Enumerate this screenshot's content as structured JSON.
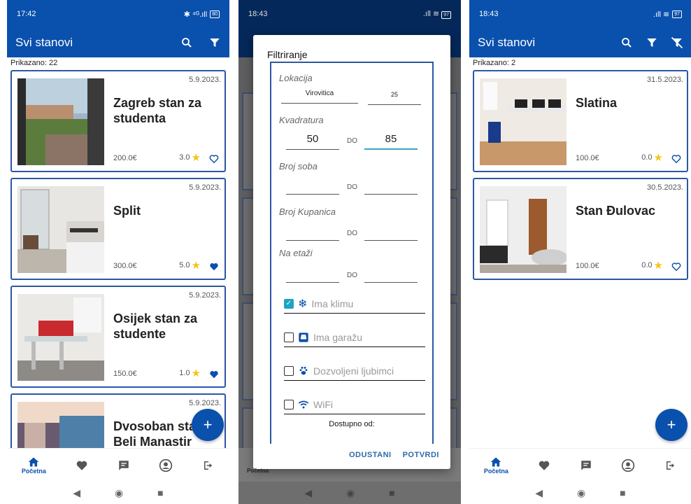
{
  "screen1": {
    "status_time": "17:42",
    "status_icons": "✉ 𝕏",
    "status_right": "✱ ⁴ᴳ.ıll",
    "battery": "80",
    "title": "Svi stanovi",
    "count": "Prikazano: 22",
    "listings": [
      {
        "date": "5.9.2023.",
        "name": "Zagreb stan za studenta",
        "price": "200.0€",
        "rating": "3.0",
        "favorite": false
      },
      {
        "date": "5.9.2023.",
        "name": "Split",
        "price": "300.0€",
        "rating": "5.0",
        "favorite": true
      },
      {
        "date": "5.9.2023.",
        "name": "Osijek stan za studente",
        "price": "150.0€",
        "rating": "1.0",
        "favorite": true
      },
      {
        "date": "5.9.2023.",
        "name": "Dvosoban stan Beli Manastir",
        "price": "",
        "rating": "",
        "favorite": false
      }
    ],
    "fab_label": "+",
    "nav_home_label": "Početna"
  },
  "screen2": {
    "status_time": "18:43",
    "battery": "97",
    "dialog_title": "Filtriranje",
    "location_label": "Lokacija",
    "location_value": "Virovitica",
    "location_radius": "25",
    "area_label": "Kvadratura",
    "area_min": "50",
    "area_max": "85",
    "do_label": "DO",
    "rooms_label": "Broj soba",
    "bathrooms_label": "Broj Kupanica",
    "floor_label": "Na etaži",
    "checkboxes": [
      {
        "label": "Ima klimu",
        "checked": true,
        "icon": "snowflake-icon"
      },
      {
        "label": "Ima garažu",
        "checked": false,
        "icon": "garage-icon"
      },
      {
        "label": "Dozvoljeni ljubimci",
        "checked": false,
        "icon": "paw-icon"
      },
      {
        "label": "WiFi",
        "checked": false,
        "icon": "wifi-icon"
      }
    ],
    "available_from_label": "Dostupno od:",
    "cancel_label": "ODUSTANI",
    "confirm_label": "POTVRDI",
    "nav_home_label": "Početna"
  },
  "screen3": {
    "status_time": "18:43",
    "battery": "97",
    "title": "Svi stanovi",
    "count": "Prikazano: 2",
    "listings": [
      {
        "date": "31.5.2023.",
        "name": "Slatina",
        "price": "100.0€",
        "rating": "0.0",
        "favorite": false
      },
      {
        "date": "30.5.2023.",
        "name": "Stan Đulovac",
        "price": "100.0€",
        "rating": "0.0",
        "favorite": false
      }
    ],
    "fab_label": "+",
    "nav_home_label": "Početna"
  },
  "colors": {
    "primary": "#0a50ad",
    "card_border": "#2c57a4",
    "star": "#f5c518",
    "accent": "#1fa3c2"
  }
}
